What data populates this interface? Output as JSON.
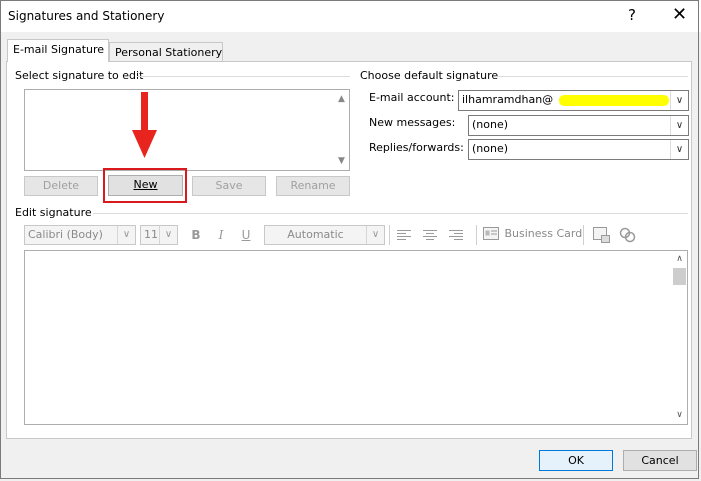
{
  "window": {
    "title": "Signatures and Stationery",
    "help_label": "?",
    "close_label": "✕"
  },
  "tabs": [
    {
      "label": "E-mail Signature",
      "active": true
    },
    {
      "label": "Personal Stationery",
      "active": false
    }
  ],
  "select_signature": {
    "heading": "Select signature to edit",
    "buttons": {
      "delete": "Delete",
      "new": "New",
      "save": "Save",
      "rename": "Rename"
    }
  },
  "default_signature": {
    "heading": "Choose default signature",
    "email_account_label": "E-mail account:",
    "email_account_value": "ilhamramdhan@",
    "new_messages_label": "New messages:",
    "new_messages_value": "(none)",
    "replies_label": "Replies/forwards:",
    "replies_value": "(none)"
  },
  "edit_signature": {
    "heading": "Edit signature",
    "font_name": "Calibri (Body)",
    "font_size": "11",
    "bold": "B",
    "italic": "I",
    "underline": "U",
    "color": "Automatic",
    "business_card": "Business Card"
  },
  "footer": {
    "ok": "OK",
    "cancel": "Cancel"
  },
  "colors": {
    "highlight_red": "#d9191c",
    "redaction_yellow": "#ffff00"
  }
}
